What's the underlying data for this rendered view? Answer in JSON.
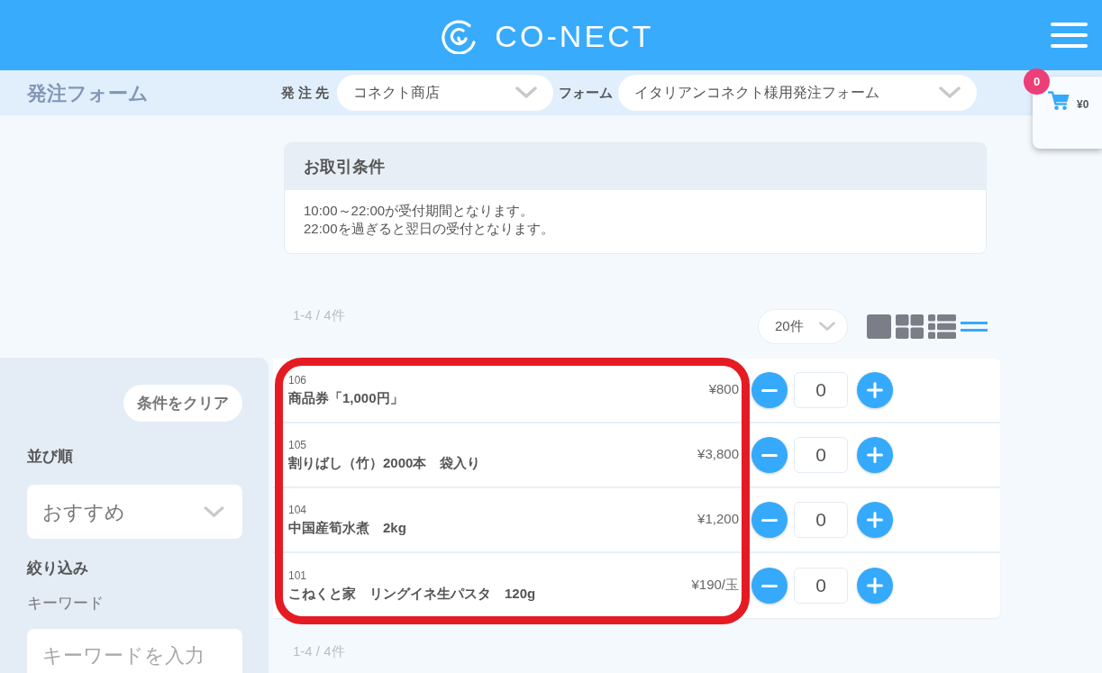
{
  "header": {
    "logo_text": "CO-NECT"
  },
  "subheader": {
    "page_title": "発注フォーム",
    "supplier": {
      "label": "発 注 先",
      "value": "コネクト商店"
    },
    "form": {
      "label": "フォーム",
      "value": "イタリアンコネクト様用発注フォーム"
    }
  },
  "cart": {
    "badge": "0",
    "total": "¥0"
  },
  "sidebar": {
    "clear_button": "条件をクリア",
    "sort": {
      "label": "並び順",
      "value": "おすすめ"
    },
    "filter_heading": "絞り込み",
    "keyword": {
      "label": "キーワード",
      "placeholder": "キーワードを入力"
    }
  },
  "terms": {
    "title": "お取引条件",
    "lines": [
      "10:00～22:00が受付期間となります。",
      "22:00を過ぎると翌日の受付となります。"
    ]
  },
  "result_count_top": "1-4 / 4件",
  "per_page": "20件",
  "view_options": [
    {
      "kind": "single",
      "selected": false
    },
    {
      "kind": "grid",
      "selected": false
    },
    {
      "kind": "list",
      "selected": false
    },
    {
      "kind": "lines",
      "selected": true
    }
  ],
  "product_list": {
    "highlighted": true,
    "items": [
      {
        "code": "106",
        "name": "商品券「1,000円」",
        "price": "¥800",
        "quantity": "0"
      },
      {
        "code": "105",
        "name": "割りばし（竹）2000本　袋入り",
        "price": "¥3,800",
        "quantity": "0"
      },
      {
        "code": "104",
        "name": "中国産筍水煮　2kg",
        "price": "¥1,200",
        "quantity": "0"
      },
      {
        "code": "101",
        "name": "こねくと家　リングイネ生パスタ　120g",
        "price": "¥190/玉",
        "quantity": "0"
      }
    ]
  },
  "result_count_bottom": "1-4 / 4件"
}
